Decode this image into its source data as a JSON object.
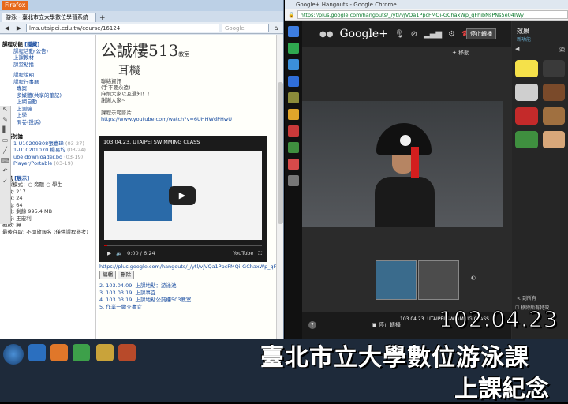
{
  "firefox": {
    "menu_label": "Firefox",
    "tab_title": "游泳 - 臺北市立大學數位學習系統",
    "url": "lms.utaipei.edu.tw/course/16124",
    "search_placeholder": "Google"
  },
  "sidebar": {
    "section1": "課程功能",
    "section1_note": "[隱藏]",
    "items1": [
      "課程活動(公告)",
      "上課教材",
      "課堂點播"
    ],
    "section2_items": [
      "課程說明",
      "課程行事曆",
      "",
      "",
      "專案",
      "多媒體(共享的筆記)",
      "上網自動",
      "上測驗",
      "上學",
      "問卷(投訴)"
    ],
    "discussion_title": "最新討論",
    "discussions": [
      {
        "text": "1-U10209308張嘉瑋",
        "date": "(03-27)"
      },
      {
        "text": "1-U10201070 楊易均",
        "date": "(03-24)"
      },
      {
        "text": "ube downloader.bd",
        "date": "(03-19)"
      },
      {
        "text": "Player/Portable",
        "date": "(03-19)"
      }
    ],
    "info_title": "資訊",
    "info_note": "[展示]",
    "info_rows": [
      "選課模式：○ 旁聽 ○ 學生",
      "人數: 217",
      "文章: 24",
      "討論: 64",
      "容量: 剩餘 995.4 MB",
      "作者: 王宏利",
      "觀數: 無",
      "最後存取: 不開放報名 (僅供課程參考)"
    ]
  },
  "main": {
    "building": "公誠樓513",
    "building_suffix": "教室",
    "ear_title": "耳機",
    "lines": [
      "聯絡資訊",
      "(手不要永遠)",
      "麻煩大家以互通知！！",
      "謝謝大家~"
    ],
    "section_video": "課程示範影片",
    "yt_link": "https://www.youtube.com/watch?v=6UHHWdPHwU",
    "yt": {
      "title": "103.04.23. UTAIPEI SWIMMING CLASS",
      "time": "0:00 / 6:24",
      "brand": "YouTube"
    },
    "edit_btn": "編輯",
    "delete_btn": "刪除",
    "hangout_link": "https://plus.google.com/hangouts/_/ytl/vjVQa1PpcFMQi-GChaxWp_qFhibNsPNs",
    "list": [
      "2. 103.04.09. 上課地點：游泳池",
      "3. 103.03.19. 上課事宜",
      "4. 103.03.19. 上課地點公誠樓503教室",
      "5. 作業一繳交事宜"
    ]
  },
  "chrome": {
    "window_title": "Google+ Hangouts - Google Chrome",
    "url": "https://plus.google.com/hangouts/_/ytl/vjVQa1PpcFMQi-GChaxWp_qFhibNsPNs5e04IWy",
    "brand": "Google+",
    "exit_top": "停止轉播",
    "sparkle_label": "移動",
    "exit_bottom": "停止轉播",
    "caption": "103.04.23. UTAIPEI SWIMMING CLASS",
    "question": "?"
  },
  "effects": {
    "title": "效果",
    "subtitle": "新功能！",
    "category": "頭",
    "more": "< 到所有",
    "check": "移除所有特效"
  },
  "overlay": {
    "date": "102.04.23",
    "course": "臺北市立大學數位游泳課",
    "memo": "上課紀念"
  }
}
